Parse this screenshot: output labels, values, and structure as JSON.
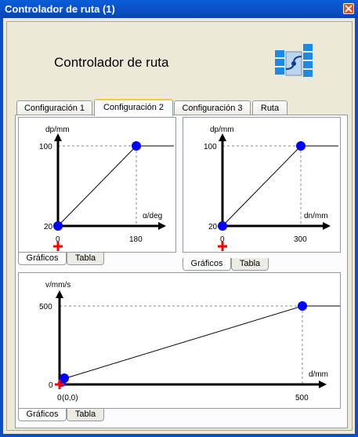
{
  "window": {
    "title": "Controlador de ruta (1)"
  },
  "heading": "Controlador de ruta",
  "tabs": [
    {
      "label": "Configuración 1",
      "active": false
    },
    {
      "label": "Configuración 2",
      "active": true
    },
    {
      "label": "Configuración 3",
      "active": false
    },
    {
      "label": "Ruta",
      "active": false
    }
  ],
  "colors": {
    "point": "#0000ff",
    "origin_marker": "#ff0000",
    "accent_tab": "#ffc83c"
  },
  "plots": [
    {
      "ylabel": "dp/mm",
      "xlabel": "α/deg",
      "y_ticks": [
        "100",
        "20"
      ],
      "x_ticks": [
        "0",
        "180"
      ],
      "subtabs": [
        "Gráficos",
        "Tabla"
      ]
    },
    {
      "ylabel": "dp/mm",
      "xlabel": "dn/mm",
      "y_ticks": [
        "100",
        "20"
      ],
      "x_ticks": [
        "0",
        "300"
      ],
      "subtabs": [
        "Gráficos",
        "Tabla"
      ]
    },
    {
      "ylabel": "v/mm/s",
      "xlabel": "d/mm",
      "y_ticks": [
        "500",
        "0"
      ],
      "x_ticks": [
        "0",
        "500"
      ],
      "origin_label": "(0,0)",
      "subtabs": [
        "Gráficos",
        "Tabla"
      ]
    }
  ]
}
